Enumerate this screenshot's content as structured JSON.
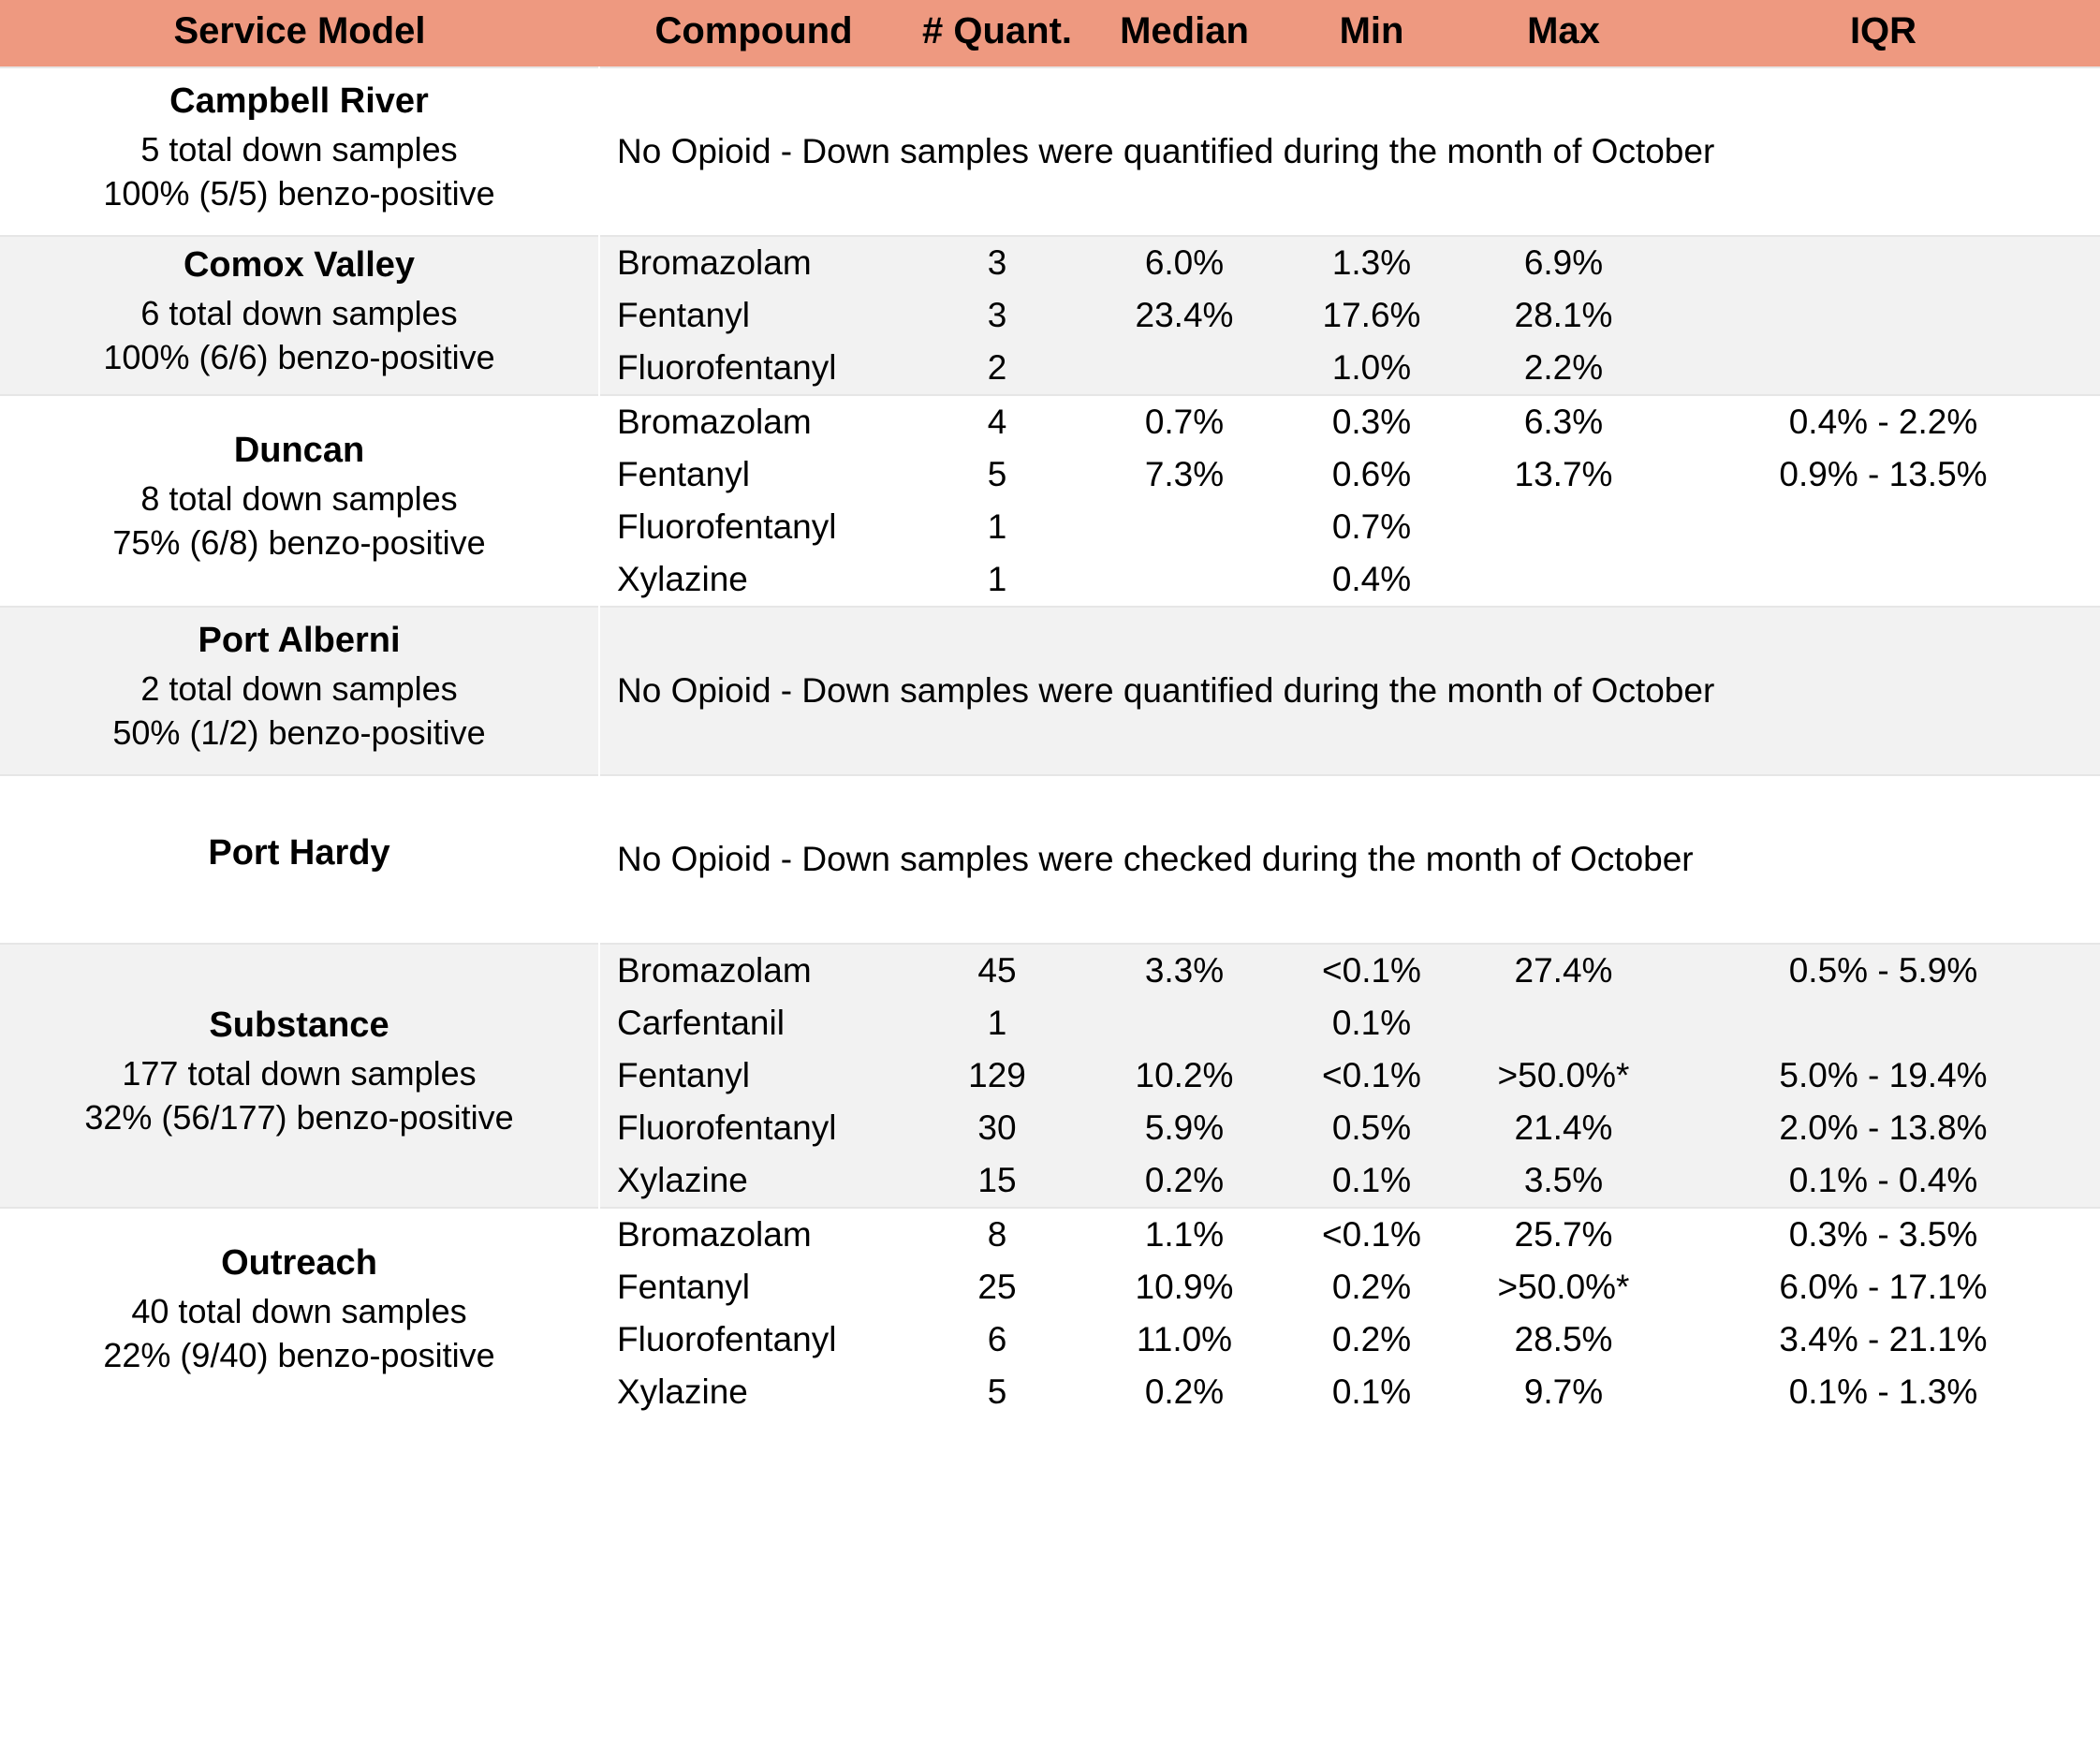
{
  "table": {
    "columns": [
      {
        "key": "service_model",
        "label": "Service Model"
      },
      {
        "key": "compound",
        "label": "Compound"
      },
      {
        "key": "n_quant",
        "label": "# Quant."
      },
      {
        "key": "median",
        "label": "Median"
      },
      {
        "key": "min",
        "label": "Min"
      },
      {
        "key": "max",
        "label": "Max"
      },
      {
        "key": "iqr",
        "label": "IQR"
      }
    ],
    "header_bg": "#EE9980",
    "row_shade_bg": "#F2F2F2",
    "row_white_bg": "#FFFFFF",
    "groups": [
      {
        "service_name": "Campbell River",
        "sub_line_1": "5 total down samples",
        "sub_line_2": "100% (5/5) benzo-positive",
        "shade": false,
        "note": "No Opioid - Down samples were quantified during the month of October",
        "rows": []
      },
      {
        "service_name": "Comox Valley",
        "sub_line_1": "6 total down samples",
        "sub_line_2": "100% (6/6) benzo-positive",
        "shade": true,
        "note": null,
        "rows": [
          {
            "compound": "Bromazolam",
            "n_quant": "3",
            "median": "6.0%",
            "min": "1.3%",
            "max": "6.9%",
            "iqr": ""
          },
          {
            "compound": "Fentanyl",
            "n_quant": "3",
            "median": "23.4%",
            "min": "17.6%",
            "max": "28.1%",
            "iqr": ""
          },
          {
            "compound": "Fluorofentanyl",
            "n_quant": "2",
            "median": "",
            "min": "1.0%",
            "max": "2.2%",
            "iqr": ""
          }
        ]
      },
      {
        "service_name": "Duncan",
        "sub_line_1": "8 total down samples",
        "sub_line_2": "75% (6/8) benzo-positive",
        "shade": false,
        "note": null,
        "rows": [
          {
            "compound": "Bromazolam",
            "n_quant": "4",
            "median": "0.7%",
            "min": "0.3%",
            "max": "6.3%",
            "iqr": "0.4% - 2.2%"
          },
          {
            "compound": "Fentanyl",
            "n_quant": "5",
            "median": "7.3%",
            "min": "0.6%",
            "max": "13.7%",
            "iqr": "0.9% - 13.5%"
          },
          {
            "compound": "Fluorofentanyl",
            "n_quant": "1",
            "median": "",
            "min": "0.7%",
            "max": "",
            "iqr": ""
          },
          {
            "compound": "Xylazine",
            "n_quant": "1",
            "median": "",
            "min": "0.4%",
            "max": "",
            "iqr": ""
          }
        ]
      },
      {
        "service_name": "Port Alberni",
        "sub_line_1": "2 total down samples",
        "sub_line_2": "50% (1/2) benzo-positive",
        "shade": true,
        "note": "No Opioid - Down samples were quantified during the month of October",
        "rows": []
      },
      {
        "service_name": "Port Hardy",
        "sub_line_1": "",
        "sub_line_2": "",
        "shade": false,
        "note": "No Opioid - Down samples were checked during the month of October",
        "rows": []
      },
      {
        "service_name": "Substance",
        "sub_line_1": "177 total down samples",
        "sub_line_2": "32% (56/177) benzo-positive",
        "shade": true,
        "note": null,
        "rows": [
          {
            "compound": "Bromazolam",
            "n_quant": "45",
            "median": "3.3%",
            "min": "<0.1%",
            "max": "27.4%",
            "iqr": "0.5% - 5.9%"
          },
          {
            "compound": "Carfentanil",
            "n_quant": "1",
            "median": "",
            "min": "0.1%",
            "max": "",
            "iqr": ""
          },
          {
            "compound": "Fentanyl",
            "n_quant": "129",
            "median": "10.2%",
            "min": "<0.1%",
            "max": ">50.0%*",
            "iqr": "5.0% - 19.4%"
          },
          {
            "compound": "Fluorofentanyl",
            "n_quant": "30",
            "median": "5.9%",
            "min": "0.5%",
            "max": "21.4%",
            "iqr": "2.0% - 13.8%"
          },
          {
            "compound": "Xylazine",
            "n_quant": "15",
            "median": "0.2%",
            "min": "0.1%",
            "max": "3.5%",
            "iqr": "0.1% - 0.4%"
          }
        ]
      },
      {
        "service_name": "Outreach",
        "sub_line_1": "40 total down samples",
        "sub_line_2": "22% (9/40) benzo-positive",
        "shade": false,
        "note": null,
        "rows": [
          {
            "compound": "Bromazolam",
            "n_quant": "8",
            "median": "1.1%",
            "min": "<0.1%",
            "max": "25.7%",
            "iqr": "0.3% - 3.5%"
          },
          {
            "compound": "Fentanyl",
            "n_quant": "25",
            "median": "10.9%",
            "min": "0.2%",
            "max": ">50.0%*",
            "iqr": "6.0% - 17.1%"
          },
          {
            "compound": "Fluorofentanyl",
            "n_quant": "6",
            "median": "11.0%",
            "min": "0.2%",
            "max": "28.5%",
            "iqr": "3.4% - 21.1%"
          },
          {
            "compound": "Xylazine",
            "n_quant": "5",
            "median": "0.2%",
            "min": "0.1%",
            "max": "9.7%",
            "iqr": "0.1% - 1.3%"
          }
        ]
      }
    ]
  }
}
